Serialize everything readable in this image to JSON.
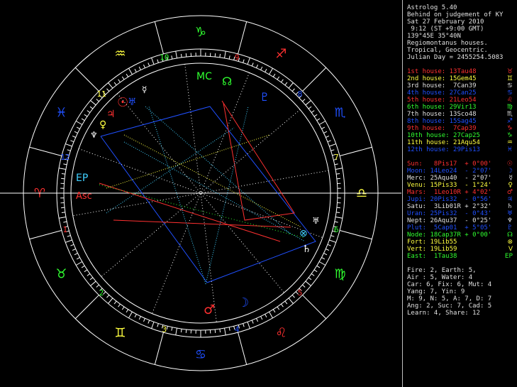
{
  "header": {
    "app": "Astrolog 5.40",
    "name": "Behind on judgement of KY",
    "date": "Sat 27 February 2010",
    "time": " 9:12 (ST +9:00 GMT)",
    "location": "139°45E 35°40N",
    "system": "Regiomontanus houses.",
    "zodiac": "Tropical, Geocentric.",
    "julian": "Julian Day = 2455254.5083"
  },
  "houses": [
    {
      "label": "1st house: 13Tau48",
      "color": "#ff3030",
      "sign": "♉"
    },
    {
      "label": "2nd house: 15Gem45",
      "color": "#ffff40",
      "sign": "♊"
    },
    {
      "label": "3rd house:  7Can39",
      "color": "#e0e0e0",
      "sign": "♋"
    },
    {
      "label": "4th house: 27Can25",
      "color": "#2050ff",
      "sign": "♋"
    },
    {
      "label": "5th house: 21Leo54",
      "color": "#ff3030",
      "sign": "♌"
    },
    {
      "label": "6th house: 29Vir13",
      "color": "#30ff30",
      "sign": "♍"
    },
    {
      "label": "7th house: 13Sco48",
      "color": "#e0e0e0",
      "sign": "♏"
    },
    {
      "label": "8th house: 15Sag45",
      "color": "#2050ff",
      "sign": "♐"
    },
    {
      "label": "9th house:  7Cap39",
      "color": "#ff3030",
      "sign": "♑"
    },
    {
      "label": "10th house: 27Cap25",
      "color": "#30ff30",
      "sign": "♑"
    },
    {
      "label": "11th house: 21Aqu54",
      "color": "#ffff40",
      "sign": "♒"
    },
    {
      "label": "12th house: 29Pis13",
      "color": "#2050ff",
      "sign": "♓"
    }
  ],
  "planets": [
    {
      "label": "Sun:   8Pis17  + 0°00'",
      "color": "#ff3030",
      "sign": "☉"
    },
    {
      "label": "Moon: 14Leo24  - 2°07'",
      "color": "#2050ff",
      "sign": "☽"
    },
    {
      "label": "Merc: 25Aqu40  - 2°07'",
      "color": "#e0e0e0",
      "sign": "☿"
    },
    {
      "label": "Venu: 15Pis33  - 1°24'",
      "color": "#ffff40",
      "sign": "♀"
    },
    {
      "label": "Mars:  1Leo10R + 4°02'",
      "color": "#ff3030",
      "sign": "♂"
    },
    {
      "label": "Jupi: 20Pis32  - 0°56'",
      "color": "#2050ff",
      "sign": "♃"
    },
    {
      "label": "Satu:  3Lib01R + 2°32'",
      "color": "#e0e0e0",
      "sign": "♄"
    },
    {
      "label": "Uran: 25Pis32  - 0°43'",
      "color": "#2050ff",
      "sign": "♅"
    },
    {
      "label": "Nept: 26Aqu37  - 0°25'",
      "color": "#e0e0e0",
      "sign": "♆"
    },
    {
      "label": "Plut:  5Cap01  + 5°05'",
      "color": "#2050ff",
      "sign": "♇"
    },
    {
      "label": "Node: 18Cap37R + 0°00'",
      "color": "#30ff30",
      "sign": "☊"
    },
    {
      "label": "Fort: 19Lib55",
      "color": "#ffff40",
      "sign": "⊗"
    },
    {
      "label": "Vert: 19Lib59",
      "color": "#ffff40",
      "sign": "V"
    },
    {
      "label": "East:  1Tau38",
      "color": "#30ff30",
      "sign": "EP"
    }
  ],
  "stats": [
    "Fire: 2, Earth: 5,",
    "Air : 5, Water: 4",
    "Car: 6, Fix: 6, Mut: 4",
    "Yang: 7, Yin: 9",
    "M: 9, N: 5, A: 7, D: 7",
    "Ang: 2, Suc: 7, Cad: 5",
    "Learn: 4, Share: 12"
  ],
  "zodiac_glyphs": [
    {
      "sign": "♑",
      "color": "#30ff30"
    },
    {
      "sign": "♐",
      "color": "#ff3030"
    },
    {
      "sign": "♏",
      "color": "#2050ff"
    },
    {
      "sign": "♎",
      "color": "#ffff40"
    },
    {
      "sign": "♍",
      "color": "#30ff30"
    },
    {
      "sign": "♌",
      "color": "#ff3030"
    },
    {
      "sign": "♋",
      "color": "#2050ff"
    },
    {
      "sign": "♊",
      "color": "#ffff40"
    },
    {
      "sign": "♉",
      "color": "#30ff30"
    },
    {
      "sign": "♈",
      "color": "#ff3030"
    },
    {
      "sign": "♓",
      "color": "#2050ff"
    },
    {
      "sign": "♒",
      "color": "#ffff40"
    }
  ],
  "house_numbers": [
    {
      "n": "10",
      "color": "#30ff30"
    },
    {
      "n": "9",
      "color": "#ff3030"
    },
    {
      "n": "8",
      "color": "#2050ff"
    },
    {
      "n": "7",
      "color": "#ffff40"
    },
    {
      "n": "6",
      "color": "#30ff30"
    },
    {
      "n": "5",
      "color": "#ff3030"
    },
    {
      "n": "4",
      "color": "#2050ff"
    },
    {
      "n": "3",
      "color": "#ffff40"
    },
    {
      "n": "2",
      "color": "#30ff30"
    },
    {
      "n": "1",
      "color": "#ff3030"
    },
    {
      "n": "12",
      "color": "#2050ff"
    },
    {
      "n": "11",
      "color": "#ffff40"
    }
  ],
  "chart_markers": {
    "mc": "MC",
    "asc": "Asc",
    "ep": "EP"
  },
  "colors": {
    "background": "#000000",
    "frame": "#c0c0c0",
    "header_text": "#e0e0e0",
    "red": "#ff3030",
    "blue": "#2050ff",
    "green": "#30ff30",
    "yellow": "#ffff40",
    "cyan": "#40d0ff"
  }
}
